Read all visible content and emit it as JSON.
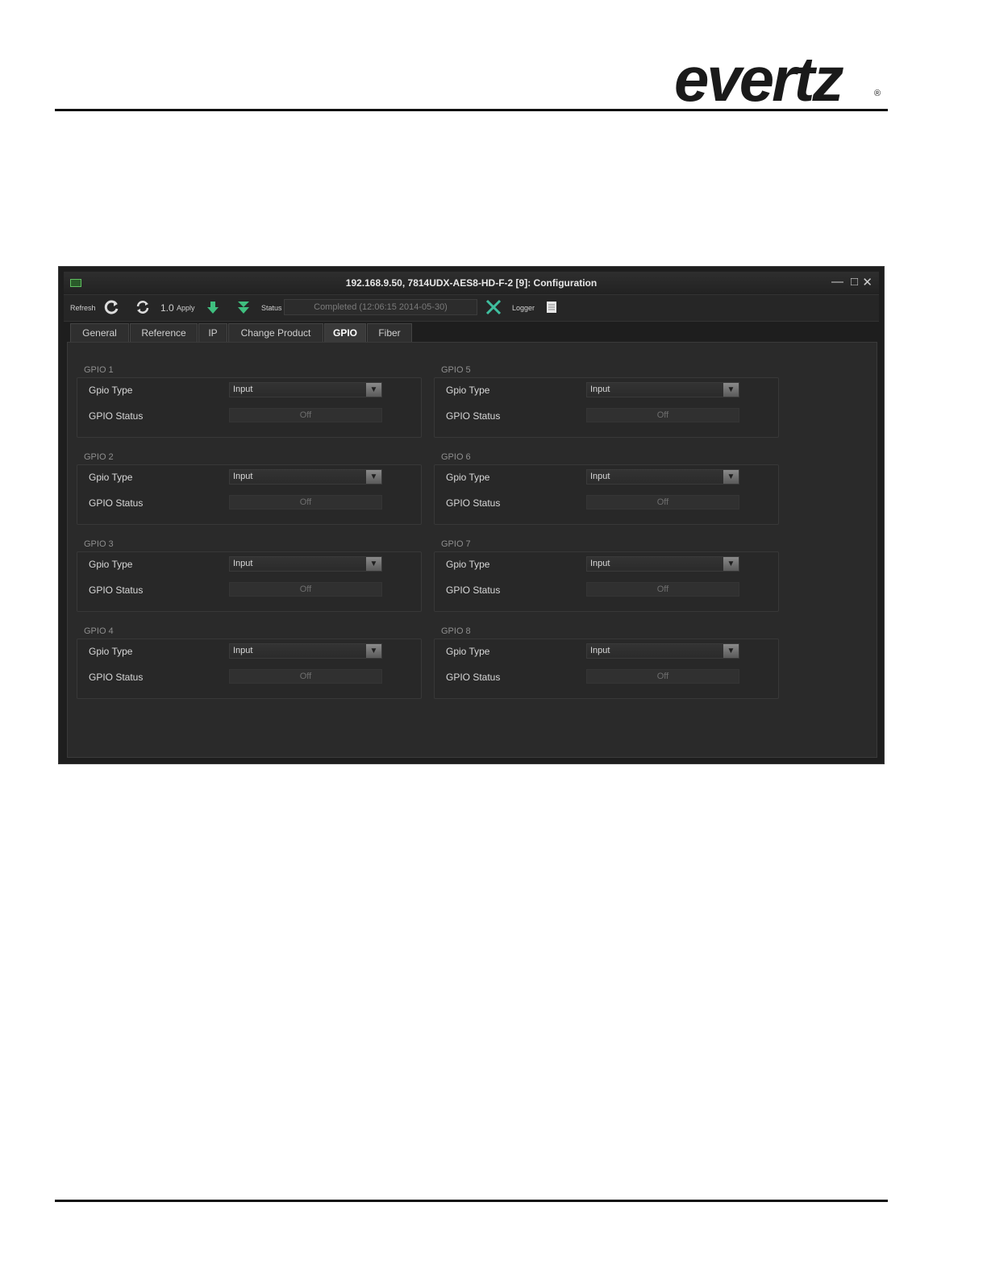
{
  "brand": {
    "logo_text": "evertz",
    "reg_mark": "®"
  },
  "window": {
    "title": "192.168.9.50, 7814UDX-AES8-HD-F-2  [9]: Configuration",
    "controls": {
      "minimize": "—",
      "maximize": "□",
      "close": "✕"
    }
  },
  "toolbar": {
    "refresh_label": "Refresh",
    "interval_value": "1.0",
    "apply_label": "Apply",
    "status_label": "Status",
    "status_value": "Completed  (12:06:15  2014-05-30)",
    "logger_label": "Logger",
    "icons": [
      "refresh-icon",
      "auto-refresh-icon",
      "apply-down-icon",
      "apply-all-icon",
      "cancel-x-icon",
      "logger-icon"
    ]
  },
  "tabs": [
    {
      "label": "General",
      "active": false
    },
    {
      "label": "Reference",
      "active": false
    },
    {
      "label": "IP",
      "active": false
    },
    {
      "label": "Change Product",
      "active": false
    },
    {
      "label": "GPIO",
      "active": true
    },
    {
      "label": "Fiber",
      "active": false
    }
  ],
  "gpio_groups": [
    {
      "title": "GPIO 1",
      "type_label": "Gpio Type",
      "type_value": "Input",
      "status_label": "GPIO Status",
      "status_value": "Off"
    },
    {
      "title": "GPIO 2",
      "type_label": "Gpio Type",
      "type_value": "Input",
      "status_label": "GPIO Status",
      "status_value": "Off"
    },
    {
      "title": "GPIO 3",
      "type_label": "Gpio Type",
      "type_value": "Input",
      "status_label": "GPIO Status",
      "status_value": "Off"
    },
    {
      "title": "GPIO 4",
      "type_label": "Gpio Type",
      "type_value": "Input",
      "status_label": "GPIO Status",
      "status_value": "Off"
    },
    {
      "title": "GPIO 5",
      "type_label": "Gpio Type",
      "type_value": "Input",
      "status_label": "GPIO Status",
      "status_value": "Off"
    },
    {
      "title": "GPIO 6",
      "type_label": "Gpio Type",
      "type_value": "Input",
      "status_label": "GPIO Status",
      "status_value": "Off"
    },
    {
      "title": "GPIO 7",
      "type_label": "Gpio Type",
      "type_value": "Input",
      "status_label": "GPIO Status",
      "status_value": "Off"
    },
    {
      "title": "GPIO 8",
      "type_label": "Gpio Type",
      "type_value": "Input",
      "status_label": "GPIO Status",
      "status_value": "Off"
    }
  ],
  "colors": {
    "window_bg": "#1e1e1e",
    "panel_bg": "#2a2a2a",
    "accent_green": "#3fbf7f"
  }
}
